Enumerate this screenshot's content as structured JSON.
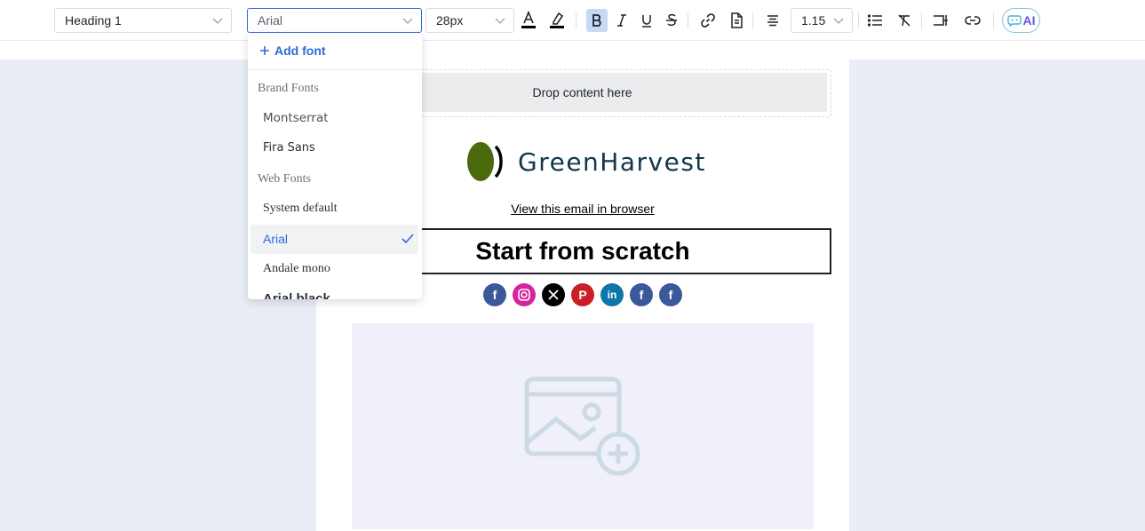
{
  "toolbar": {
    "block_type": "Heading 1",
    "font": "Arial",
    "font_size": "28px",
    "line_height": "1.15",
    "ai_label": "AI",
    "accent": "#2b6bdc"
  },
  "font_dropdown": {
    "add_font_label": "Add font",
    "groups": [
      {
        "label": "Brand Fonts",
        "options": [
          "Montserrat",
          "Fira Sans"
        ]
      },
      {
        "label": "Web Fonts",
        "options": [
          "System default",
          "Arial",
          "Andale mono",
          "Arial black"
        ]
      }
    ],
    "selected": "Arial"
  },
  "email": {
    "drop_text": "Drop content here",
    "brand_name": "GreenHarvest",
    "view_in_browser": "View this email in browser",
    "heading": "Start from scratch",
    "social_icons": [
      "facebook-icon",
      "instagram-icon",
      "x-icon",
      "pinterest-icon",
      "linkedin-icon",
      "facebook-icon",
      "facebook-icon"
    ]
  }
}
